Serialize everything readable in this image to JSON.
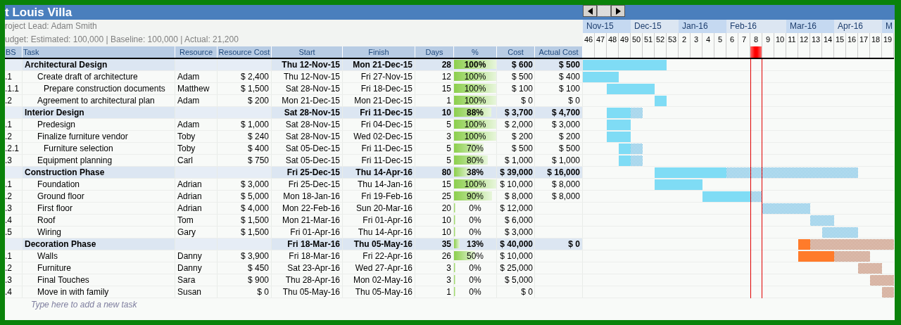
{
  "title": "t Louis Villa",
  "project_lead": "roject Lead: Adam Smith",
  "budget": "udget: Estimated: 100,000 | Baseline: 100,000 | Actual: 21,200",
  "columns": [
    "BS",
    "Task",
    "Resource",
    "Resource Cost",
    "Start",
    "Finish",
    "Days",
    "%",
    "Cost",
    "Actual Cost"
  ],
  "months": [
    "Nov-15",
    "Dec-15",
    "Jan-16",
    "Feb-16",
    "Mar-16",
    "Apr-16",
    "M"
  ],
  "weeks": [
    {
      "label": "46",
      "selected": false
    },
    {
      "label": "47",
      "selected": false
    },
    {
      "label": "48",
      "selected": false
    },
    {
      "label": "49",
      "selected": false
    },
    {
      "label": "50",
      "selected": false
    },
    {
      "label": "51",
      "selected": false
    },
    {
      "label": "52",
      "selected": false
    },
    {
      "label": "53",
      "selected": false
    },
    {
      "label": "2",
      "selected": false
    },
    {
      "label": "3",
      "selected": false
    },
    {
      "label": "4",
      "selected": false
    },
    {
      "label": "5",
      "selected": false
    },
    {
      "label": "6",
      "selected": false
    },
    {
      "label": "7",
      "selected": false
    },
    {
      "label": "8",
      "selected": true
    },
    {
      "label": "9",
      "selected": false
    },
    {
      "label": "10",
      "selected": false
    },
    {
      "label": "11",
      "selected": false
    },
    {
      "label": "12",
      "selected": false
    },
    {
      "label": "13",
      "selected": false
    },
    {
      "label": "14",
      "selected": false
    },
    {
      "label": "15",
      "selected": false
    },
    {
      "label": "16",
      "selected": false
    },
    {
      "label": "17",
      "selected": false
    },
    {
      "label": "18",
      "selected": false
    },
    {
      "label": "19",
      "selected": false
    }
  ],
  "rows": [
    {
      "kind": "phase",
      "task": "Architectural Design",
      "start": "Thu 12-Nov-15",
      "finish": "Mon 21-Dec-15",
      "days": "28",
      "percent": "100%",
      "level": 1,
      "cost": "$ 600",
      "actual_cost": "$ 500",
      "color": "#7fdcf5",
      "children": [
        {
          "kind": "task",
          "wbs": ".1",
          "task": "Create draft of architecture",
          "resource": "Adam",
          "resource_cost": "$ 2,400",
          "start": "Thu 12-Nov-15",
          "finish": "Fri 27-Nov-15",
          "days": "12",
          "percent": "100%",
          "level": 1,
          "cost": "$ 500",
          "actual_cost": "$ 400",
          "children": [
            {
              "kind": "task",
              "wbs": ".1.1",
              "task": "Prepare construction documents",
              "resource": "Matthew",
              "resource_cost": "$ 1,500",
              "start": "Sat 28-Nov-15",
              "finish": "Fri 18-Dec-15",
              "days": "15",
              "percent": "100%",
              "level": 1,
              "cost": "$ 100",
              "actual_cost": "$ 100"
            }
          ]
        },
        {
          "kind": "task",
          "wbs": ".2",
          "task": "Agreement to architectural plan",
          "resource": "Adam",
          "resource_cost": "$ 200",
          "start": "Mon 21-Dec-15",
          "finish": "Mon 21-Dec-15",
          "days": "1",
          "percent": "100%",
          "level": 1,
          "cost": "$ 0",
          "actual_cost": "$ 0"
        }
      ]
    },
    {
      "kind": "phase",
      "task": "Interior Design",
      "start": "Sat 28-Nov-15",
      "finish": "Fri 11-Dec-15",
      "days": "10",
      "percent": "88%",
      "level": 0.88,
      "cost": "$ 3,700",
      "actual_cost": "$ 4,700",
      "color": "#7fdcf5",
      "children": [
        {
          "kind": "task",
          "wbs": ".1",
          "task": "Predesign",
          "resource": "Adam",
          "resource_cost": "$ 1,000",
          "start": "Sat 28-Nov-15",
          "finish": "Fri 04-Dec-15",
          "days": "5",
          "percent": "100%",
          "level": 1,
          "cost": "$ 2,000",
          "actual_cost": "$ 3,000"
        },
        {
          "kind": "task",
          "wbs": ".2",
          "task": "Finalize furniture vendor",
          "resource": "Toby",
          "resource_cost": "$ 240",
          "start": "Sat 28-Nov-15",
          "finish": "Wed 02-Dec-15",
          "days": "3",
          "percent": "100%",
          "level": 1,
          "cost": "$ 200",
          "actual_cost": "$ 200",
          "children": [
            {
              "kind": "task",
              "wbs": ".2.1",
              "task": "Furniture selection",
              "resource": "Toby",
              "resource_cost": "$ 400",
              "start": "Sat 05-Dec-15",
              "finish": "Fri 11-Dec-15",
              "days": "5",
              "percent": "70%",
              "level": 0.7,
              "cost": "$ 500",
              "actual_cost": "$ 500"
            }
          ]
        },
        {
          "kind": "task",
          "wbs": ".3",
          "task": "Equipment planning",
          "resource": "Carl",
          "resource_cost": "$ 750",
          "start": "Sat 05-Dec-15",
          "finish": "Fri 11-Dec-15",
          "days": "5",
          "percent": "80%",
          "level": 0.8,
          "cost": "$ 1,000",
          "actual_cost": "$ 1,000"
        }
      ]
    },
    {
      "kind": "phase",
      "task": "Construction Phase",
      "start": "Fri 25-Dec-15",
      "finish": "Thu 14-Apr-16",
      "days": "80",
      "percent": "38%",
      "level": 0.38,
      "cost": "$ 39,000",
      "actual_cost": "$ 16,000",
      "color": "#7fdcf5",
      "children": [
        {
          "kind": "task",
          "wbs": ".1",
          "task": "Foundation",
          "resource": "Adrian",
          "resource_cost": "$ 3,000",
          "start": "Fri 25-Dec-15",
          "finish": "Thu 14-Jan-16",
          "days": "15",
          "percent": "100%",
          "level": 1,
          "cost": "$ 10,000",
          "actual_cost": "$ 8,000"
        },
        {
          "kind": "task",
          "wbs": ".2",
          "task": "Ground floor",
          "resource": "Adrian",
          "resource_cost": "$ 5,000",
          "start": "Mon 18-Jan-16",
          "finish": "Fri 19-Feb-16",
          "days": "25",
          "percent": "90%",
          "level": 0.9,
          "cost": "$ 8,000",
          "actual_cost": "$ 8,000"
        },
        {
          "kind": "task",
          "wbs": ".3",
          "task": "First floor",
          "resource": "Adrian",
          "resource_cost": "$ 4,000",
          "start": "Mon 22-Feb-16",
          "finish": "Sun 20-Mar-16",
          "days": "20",
          "percent": "0%",
          "level": 0,
          "cost": "$ 12,000"
        },
        {
          "kind": "task",
          "wbs": ".4",
          "task": "Roof",
          "resource": "Tom",
          "resource_cost": "$ 1,500",
          "start": "Mon 21-Mar-16",
          "finish": "Fri 01-Apr-16",
          "days": "10",
          "percent": "0%",
          "level": 0,
          "cost": "$ 6,000"
        },
        {
          "kind": "task",
          "wbs": ".5",
          "task": "Wiring",
          "resource": "Gary",
          "resource_cost": "$ 1,500",
          "start": "Fri 01-Apr-16",
          "finish": "Thu 14-Apr-16",
          "days": "10",
          "percent": "0%",
          "level": 0,
          "cost": "$ 3,000"
        }
      ]
    },
    {
      "kind": "phase",
      "task": "Decoration Phase",
      "start": "Fri 18-Mar-16",
      "finish": "Thu 05-May-16",
      "days": "35",
      "percent": "13%",
      "level": 0.13,
      "cost": "$ 40,000",
      "actual_cost": "$ 0",
      "color": "#ff7b2a",
      "children": [
        {
          "kind": "task",
          "wbs": ".1",
          "task": "Walls",
          "resource": "Danny",
          "resource_cost": "$ 3,900",
          "start": "Fri 18-Mar-16",
          "finish": "Fri 22-Apr-16",
          "days": "26",
          "percent": "50%",
          "level": 0.5,
          "cost": "$ 10,000"
        },
        {
          "kind": "task",
          "wbs": ".2",
          "task": "Furniture",
          "resource": "Danny",
          "resource_cost": "$ 450",
          "start": "Sat 23-Apr-16",
          "finish": "Wed 27-Apr-16",
          "days": "3",
          "percent": "0%",
          "level": 0,
          "cost": "$ 25,000"
        },
        {
          "kind": "task",
          "wbs": ".3",
          "task": "Final Touches",
          "resource": "Sara",
          "resource_cost": "$ 900",
          "start": "Thu 28-Apr-16",
          "finish": "Mon 02-May-16",
          "days": "3",
          "percent": "0%",
          "level": 0,
          "cost": "$ 5,000"
        },
        {
          "kind": "task",
          "wbs": ".4",
          "task": "Move in with family",
          "resource": "Susan",
          "resource_cost": "$ 0",
          "start": "Thu 05-May-16",
          "finish": "Thu 05-May-16",
          "days": "1",
          "percent": "0%",
          "level": 0,
          "cost": "$ 0"
        }
      ]
    }
  ],
  "new_task": {
    "placeholder": "Type here to add a new task"
  }
}
